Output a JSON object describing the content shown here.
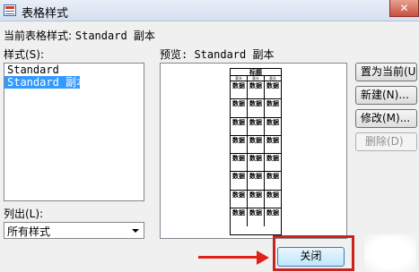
{
  "window": {
    "title": "表格样式",
    "close_glyph": "✕"
  },
  "current_style": {
    "label": "当前表格样式:",
    "value": "Standard 副本"
  },
  "styles": {
    "label": "样式(S):",
    "items": [
      {
        "label": "Standard",
        "selected": false
      },
      {
        "label": "Standard 副本",
        "selected": true
      }
    ]
  },
  "list_filter": {
    "label": "列出(L):",
    "selected": "所有样式"
  },
  "preview": {
    "label": "预览: Standard 副本",
    "table_title": "标题",
    "headers": [
      "表头",
      "表头",
      "表头"
    ],
    "rows": [
      [
        "数据",
        "数据",
        "数据"
      ],
      [
        "数据",
        "数据",
        "数据"
      ],
      [
        "数据",
        "数据",
        "数据"
      ],
      [
        "数据",
        "数据",
        "数据"
      ],
      [
        "数据",
        "数据",
        "数据"
      ],
      [
        "数据",
        "数据",
        "数据"
      ],
      [
        "数据",
        "数据",
        "数据"
      ],
      [
        "数据",
        "数据",
        "数据"
      ]
    ]
  },
  "buttons": {
    "set_current": "置为当前(U)",
    "new": "新建(N)...",
    "modify": "修改(M)...",
    "delete": "删除(D)",
    "close": "关闭"
  },
  "colors": {
    "selection": "#3399ff",
    "annotation_red": "#c8231e"
  }
}
